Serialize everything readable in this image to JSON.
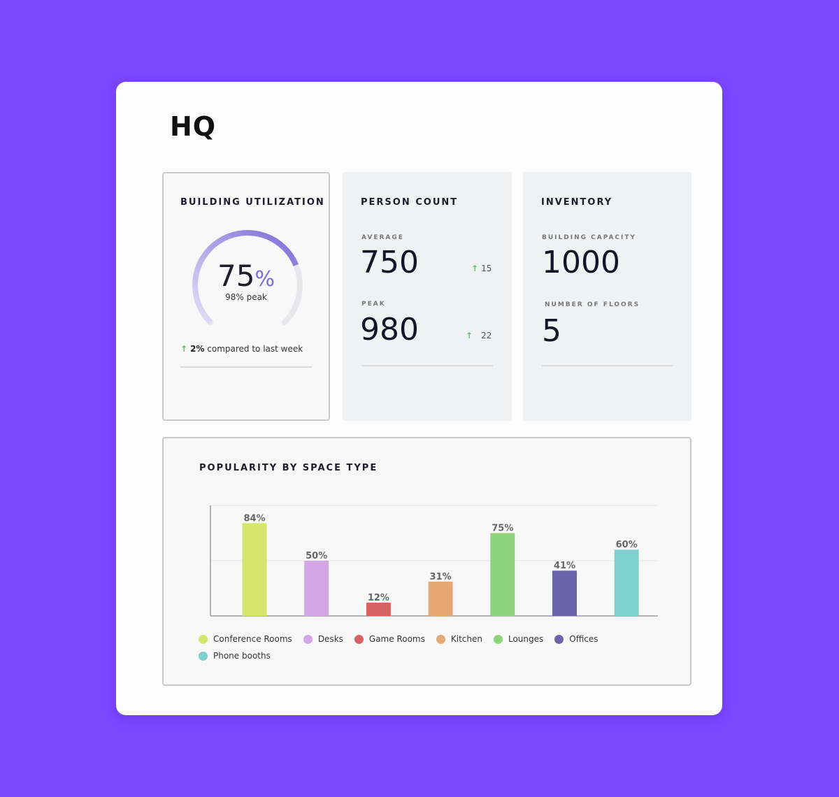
{
  "page": {
    "title": "HQ"
  },
  "utilization": {
    "title": "BUILDING UTILIZATION",
    "value": "75",
    "unit": "%",
    "fraction": 0.75,
    "peak_label": "98% peak",
    "compare_value": "2%",
    "compare_text": " compared to last week"
  },
  "person_count": {
    "title": "PERSON COUNT",
    "average_label": "AVERAGE",
    "average_value": "750",
    "average_delta": "15",
    "peak_label": "PEAK",
    "peak_value": "980",
    "peak_delta": "22"
  },
  "inventory": {
    "title": "INVENTORY",
    "capacity_label": "BUILDING CAPACITY",
    "capacity_value": "1000",
    "floors_label": "NUMBER OF FLOORS",
    "floors_value": "5"
  },
  "chart_data": {
    "type": "bar",
    "title": "POPULARITY BY SPACE TYPE",
    "categories": [
      "Conference Rooms",
      "Desks",
      "Game Rooms",
      "Kitchen",
      "Lounges",
      "Offices",
      "Phone booths"
    ],
    "values": [
      84,
      50,
      12,
      31,
      75,
      41,
      60
    ],
    "data_labels": [
      "84%",
      "50%",
      "12%",
      "31%",
      "75%",
      "41%",
      "60%"
    ],
    "colors": [
      "#d4e66b",
      "#d4a6e4",
      "#d66262",
      "#e6a974",
      "#8fd47c",
      "#6b64aa",
      "#7fcfcf"
    ],
    "ylim": [
      0,
      100
    ],
    "grid": true,
    "legend_position": "bottom"
  },
  "colors": {
    "background": "#7b47ff",
    "gauge": "#7c6bd6",
    "up_arrow": "#58c36a"
  }
}
